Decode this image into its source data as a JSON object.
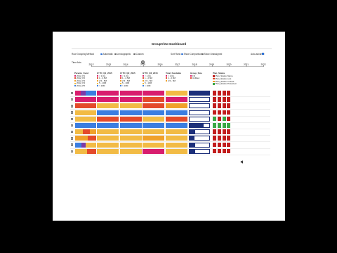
{
  "dashboard": {
    "title": "GroupView Dashboard"
  },
  "controls": {
    "grouping_label": "Row Grouping Method",
    "grouping_options": [
      "Automatic",
      "Lexicographic",
      "Custom"
    ],
    "sort_label": "Sort Rank",
    "sort_options": [
      "Show Comparison",
      "Show Unassigned"
    ],
    "right_label": "Auto-advance",
    "time_label": "Time Axis",
    "years": [
      "2012",
      "2013",
      "2014",
      "2015",
      "2016",
      "2017",
      "2018",
      "2019",
      "2020",
      "2021",
      "2022"
    ]
  },
  "columns": {
    "parents": {
      "header": "Parents_Fund",
      "items": [
        "2012_P1",
        "2012_P2",
        "2012_P3",
        "2012_P4",
        "2012_P5"
      ]
    },
    "c1": {
      "header": "IZ TO_Q1_2015",
      "items": [
        "< 1.0m",
        "1 - 2.5M",
        "2.5 - 5M",
        "5 - 10M",
        "> 10M"
      ]
    },
    "c2": {
      "header": "IZ TO_Q2_2015",
      "items": [
        "< 1.0m",
        "1 - 2.5M",
        "2.5 - 5M",
        "5 - 10M",
        "> 10M"
      ]
    },
    "c3": {
      "header": "IZ TO_Q3_2015",
      "items": [
        "< 1.0m",
        "1 - 2.5M",
        "2.5 - 5M",
        "5 - 10M",
        "> 10M"
      ]
    },
    "c4": {
      "header": "Total_Fundable",
      "items": [
        "< 1.0m",
        "1 - 2.5M",
        "2.5 - 5M"
      ]
    },
    "c5": {
      "header": "Group_Size",
      "items": [
        "Fill",
        "Unfilled"
      ]
    },
    "c6": {
      "header": "Plan_Status",
      "items": [
        "Plan_Status Name",
        "Plan_Status Lost",
        "Plan_Status Locked",
        "Plan_Status Protected"
      ]
    }
  },
  "colors": {
    "red": "#e44a2a",
    "orange": "#f0a12a",
    "yellow": "#f2bb45",
    "magenta": "#d81d6e",
    "blue": "#3b7de0",
    "purple": "#7b3aa8",
    "navy": "#1c2f7a",
    "darkred": "#c21d1d",
    "green": "#3aa845"
  },
  "rows": [
    {
      "parents": [
        [
          "magenta",
          0.25
        ],
        [
          "purple",
          0.25
        ],
        [
          "blue",
          0.5
        ]
      ],
      "c1": "magenta",
      "c2": "magenta",
      "c3": "magenta",
      "c4": "yellow",
      "size": 1.0,
      "status": [
        "darkred",
        "darkred",
        "darkred",
        "darkred"
      ]
    },
    {
      "parents": [
        [
          "magenta",
          1.0
        ]
      ],
      "c1": "magenta",
      "c2": "magenta",
      "c3": "red",
      "c4": "magenta",
      "size": 0.0,
      "status": [
        "darkred",
        "darkred",
        "darkred",
        "darkred"
      ]
    },
    {
      "parents": [
        [
          "red",
          1.0
        ]
      ],
      "c1": "yellow",
      "c2": "yellow",
      "c3": "red",
      "c4": "orange",
      "size": 0.0,
      "status": [
        "darkred",
        "darkred",
        "darkred",
        "darkred"
      ]
    },
    {
      "parents": [
        [
          "yellow",
          1.0
        ]
      ],
      "c1": "blue",
      "c2": "blue",
      "c3": "blue",
      "c4": "blue",
      "size": 0.0,
      "status": [
        "darkred",
        "darkred",
        "darkred",
        "darkred"
      ]
    },
    {
      "parents": [
        [
          "yellow",
          1.0
        ]
      ],
      "c1": "red",
      "c2": "red",
      "c3": "yellow",
      "c4": "red",
      "size": 0.0,
      "status": [
        "green",
        "darkred",
        "green",
        "darkred"
      ]
    },
    {
      "parents": [
        [
          "blue",
          1.0
        ]
      ],
      "c1": "blue",
      "c2": "blue",
      "c3": "blue",
      "c4": "blue",
      "size": 0.7,
      "status": [
        "green",
        "green",
        "green",
        "green"
      ]
    },
    {
      "parents": [
        [
          "yellow",
          0.35
        ],
        [
          "red",
          0.35
        ],
        [
          "orange",
          0.3
        ]
      ],
      "c1": "yellow",
      "c2": "yellow",
      "c3": "yellow",
      "c4": "yellow",
      "size": 0.3,
      "status": [
        "darkred",
        "darkred",
        "darkred",
        "darkred"
      ]
    },
    {
      "parents": [
        [
          "orange",
          0.6
        ],
        [
          "red",
          0.4
        ]
      ],
      "c1": "yellow",
      "c2": "yellow",
      "c3": "orange",
      "c4": "yellow",
      "size": 0.25,
      "status": [
        "darkred",
        "darkred",
        "darkred",
        "darkred"
      ]
    },
    {
      "parents": [
        [
          "blue",
          0.3
        ],
        [
          "purple",
          0.2
        ],
        [
          "yellow",
          0.5
        ]
      ],
      "c1": "yellow",
      "c2": "yellow",
      "c3": "yellow",
      "c4": "yellow",
      "size": 0.3,
      "status": [
        "darkred",
        "darkred",
        "darkred",
        "darkred"
      ]
    },
    {
      "parents": [
        [
          "yellow",
          0.55
        ],
        [
          "red",
          0.45
        ]
      ],
      "c1": "yellow",
      "c2": "yellow",
      "c3": "magenta",
      "c4": "yellow",
      "size": 0.3,
      "status": [
        "darkred",
        "darkred",
        "darkred",
        "darkred"
      ]
    }
  ]
}
